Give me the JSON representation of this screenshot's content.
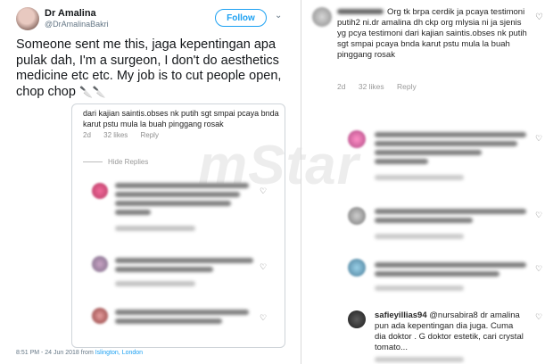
{
  "tweet": {
    "display_name": "Dr Amalina",
    "handle": "@DrAmalinaBakri",
    "follow_label": "Follow",
    "chevron": "⌄",
    "text": "Someone sent me this, jaga kepentingan apa pulak dah, I'm a surgeon, I don't do aesthetics medicine etc etc. My job is to cut people open, chop chop",
    "emoji": "🔪🔪",
    "timestamp": "8:51 PM - 24 Jun 2018 from",
    "location": "Islington, London"
  },
  "embedded_comment": {
    "caption_partial": "dari kajian saintis.obses nk putih sgt smpai pcaya bnda karut pstu mula la buah pinggang rosak",
    "age": "2d",
    "likes": "32 likes",
    "reply": "Reply",
    "hide_replies": "Hide Replies"
  },
  "watermark": "mStar",
  "ig_top_comment": {
    "text": "Org tk brpa cerdik ja pcaya testimoni putih2 ni.dr amalina dh ckp org mlysia ni ja sjenis yg pcya testimoni dari kajian saintis.obses nk putih sgt smpai pcaya bnda karut pstu mula la buah pinggang rosak",
    "age": "2d",
    "likes": "32 likes",
    "reply": "Reply"
  },
  "ig_bottom_comment": {
    "username": "safieyillias94",
    "text": "@nursabira8 dr amalina pun ada kepentingan dia juga. Cuma dia doktor . G doktor estetik, cari crystal tomato..."
  },
  "icons": {
    "heart": "heart-icon",
    "follow_chevron": "chevron-down-icon",
    "knife": "knife-icon"
  },
  "colors": {
    "twitter_blue": "#1da1f2",
    "meta_grey": "#999999"
  }
}
